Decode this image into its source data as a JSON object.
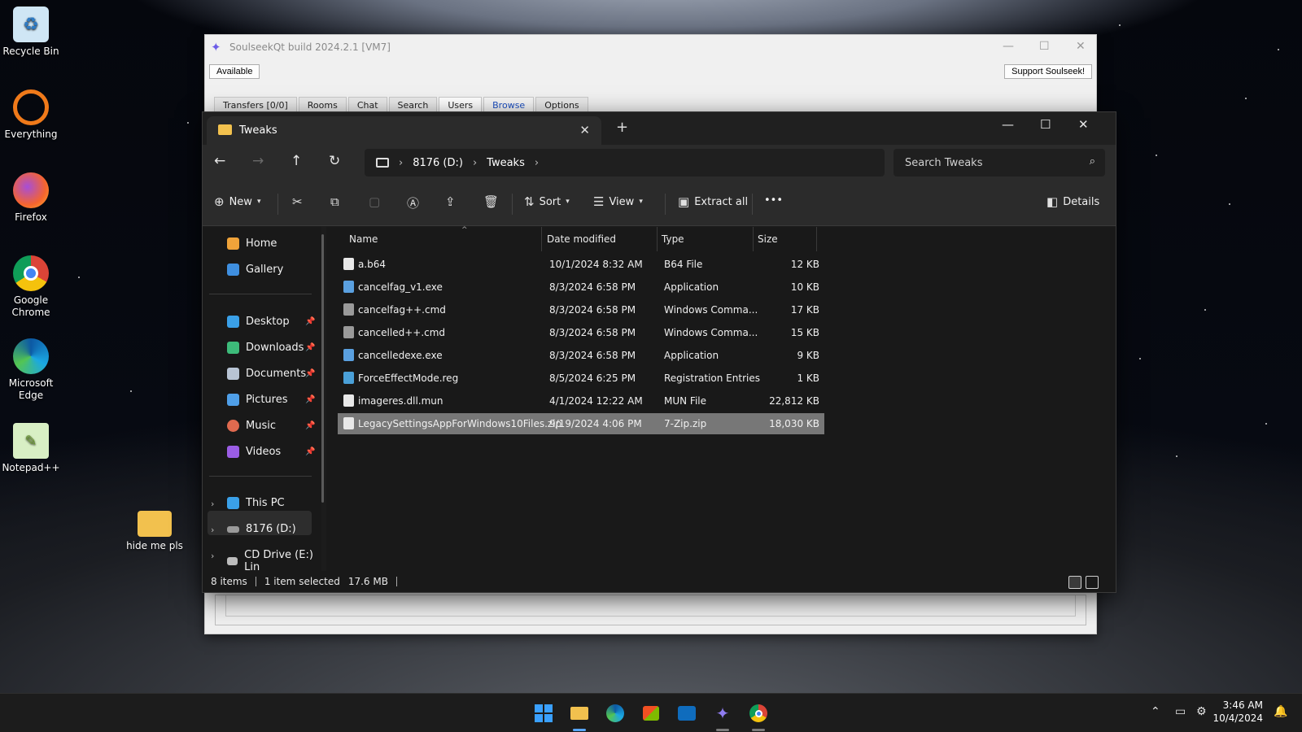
{
  "desktop": {
    "icons": [
      {
        "label": "Recycle Bin"
      },
      {
        "label": "Everything"
      },
      {
        "label": "Firefox"
      },
      {
        "label": "Google Chrome"
      },
      {
        "label": "Microsoft Edge"
      },
      {
        "label": "Notepad++"
      },
      {
        "label": "hide me pls"
      }
    ]
  },
  "soulseek": {
    "title": "SoulseekQt build 2024.2.1 [VM7]",
    "status_button": "Available",
    "support_button": "Support Soulseek!",
    "tabs": [
      {
        "label": "Transfers [0/0]"
      },
      {
        "label": "Rooms"
      },
      {
        "label": "Chat"
      },
      {
        "label": "Search"
      },
      {
        "label": "Users"
      },
      {
        "label": "Browse"
      },
      {
        "label": "Options"
      }
    ]
  },
  "explorer": {
    "tab_title": "Tweaks",
    "breadcrumb": [
      "8176 (D:)",
      "Tweaks"
    ],
    "search_placeholder": "Search Tweaks",
    "commands": {
      "new": "New",
      "sort": "Sort",
      "view": "View",
      "extract_all": "Extract all",
      "more": "•••",
      "details": "Details"
    },
    "sidebar": {
      "quick": [
        {
          "label": "Home",
          "color": "#f0a33a"
        },
        {
          "label": "Gallery",
          "color": "#3f8fe0"
        }
      ],
      "pinned": [
        {
          "label": "Desktop",
          "color": "#3aa0e8"
        },
        {
          "label": "Downloads",
          "color": "#3dbb7a"
        },
        {
          "label": "Documents",
          "color": "#b8c4d4"
        },
        {
          "label": "Pictures",
          "color": "#4f9fe8"
        },
        {
          "label": "Music",
          "color": "#e06a4f"
        },
        {
          "label": "Videos",
          "color": "#9b5de5"
        }
      ],
      "tree": [
        {
          "label": "This PC"
        },
        {
          "label": "8176 (D:)"
        },
        {
          "label": "CD Drive (E:) Lin"
        }
      ]
    },
    "columns": {
      "name": "Name",
      "date": "Date modified",
      "type": "Type",
      "size": "Size"
    },
    "files": [
      {
        "name": "a.b64",
        "date": "10/1/2024 8:32 AM",
        "type": "B64 File",
        "size": "12 KB",
        "icon": "file",
        "color": "#e8e8e8"
      },
      {
        "name": "cancelfag_v1.exe",
        "date": "8/3/2024 6:58 PM",
        "type": "Application",
        "size": "10 KB",
        "icon": "app",
        "color": "#5aa0e0"
      },
      {
        "name": "cancelfag++.cmd",
        "date": "8/3/2024 6:58 PM",
        "type": "Windows Comma...",
        "size": "17 KB",
        "icon": "cmd",
        "color": "#9a9a9a"
      },
      {
        "name": "cancelled++.cmd",
        "date": "8/3/2024 6:58 PM",
        "type": "Windows Comma...",
        "size": "15 KB",
        "icon": "cmd",
        "color": "#9a9a9a"
      },
      {
        "name": "cancelledexe.exe",
        "date": "8/3/2024 6:58 PM",
        "type": "Application",
        "size": "9 KB",
        "icon": "app",
        "color": "#5aa0e0"
      },
      {
        "name": "ForceEffectMode.reg",
        "date": "8/5/2024 6:25 PM",
        "type": "Registration Entries",
        "size": "1 KB",
        "icon": "reg",
        "color": "#4aa0d8"
      },
      {
        "name": "imageres.dll.mun",
        "date": "4/1/2024 12:22 AM",
        "type": "MUN File",
        "size": "22,812 KB",
        "icon": "file",
        "color": "#e8e8e8"
      },
      {
        "name": "LegacySettingsAppForWindows10Files.zip",
        "date": "9/19/2024 4:06 PM",
        "type": "7-Zip.zip",
        "size": "18,030 KB",
        "icon": "zip",
        "color": "#e8e8e8",
        "selected": true
      }
    ],
    "status": {
      "count": "8 items",
      "selection": "1 item selected",
      "size": "17.6 MB"
    }
  },
  "taskbar": {
    "time": "3:46 AM",
    "date": "10/4/2024"
  }
}
